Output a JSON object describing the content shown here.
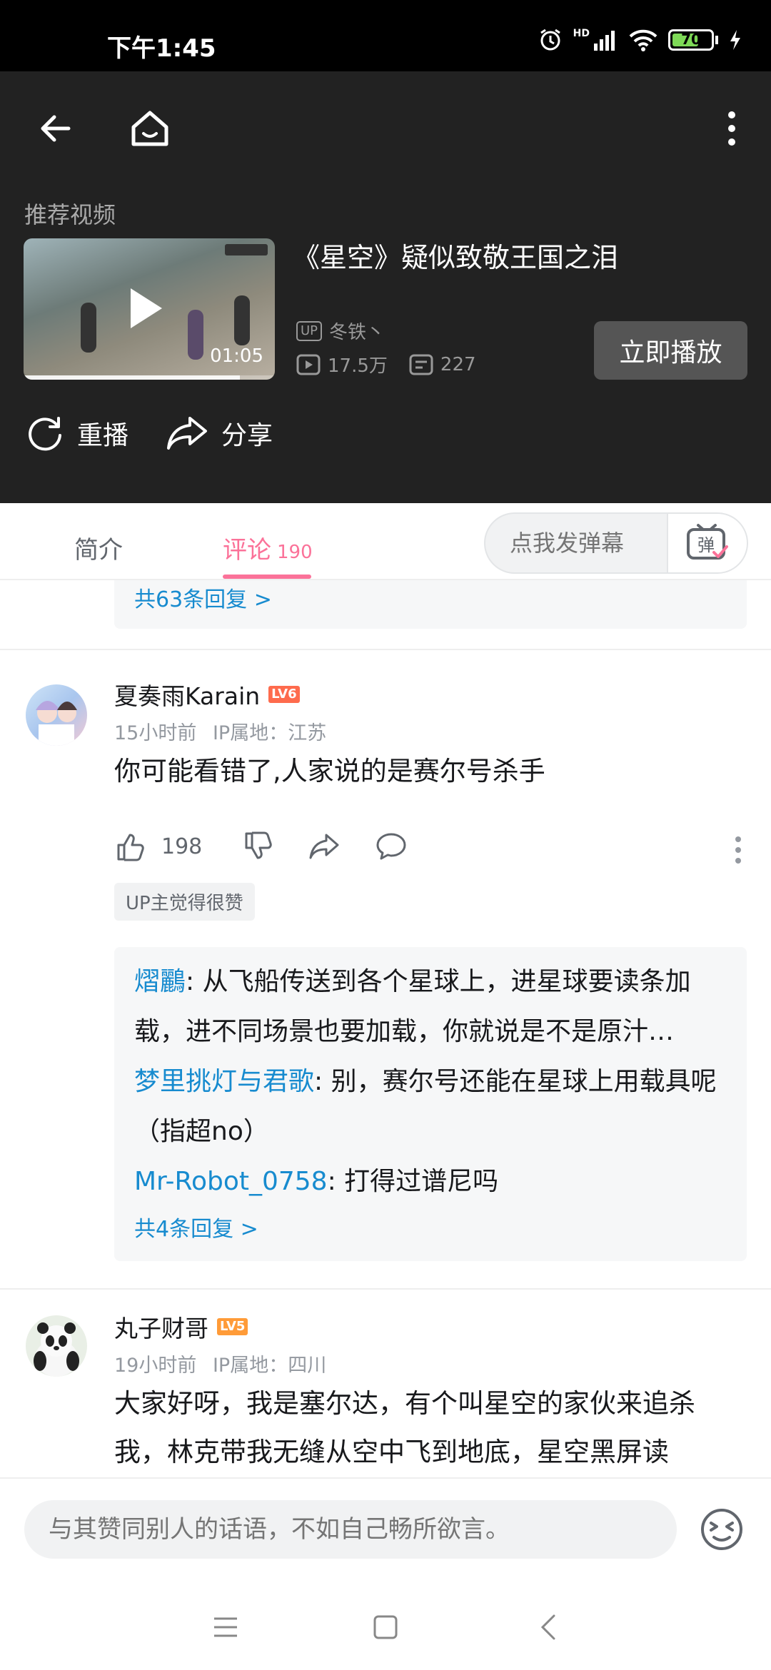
{
  "status_bar": {
    "time": "下午1:45",
    "battery": "70",
    "battery_level": 0.7,
    "network": "HD"
  },
  "header": {
    "back_icon": "back-arrow-icon",
    "home_icon": "home-icon",
    "more_icon": "more-vertical-icon"
  },
  "recommend": {
    "label": "推荐视频",
    "title": "《星空》疑似致敬王国之泪",
    "duration": "01:05",
    "progress": 0.86,
    "uploader": "冬铁丶",
    "up_badge": "UP",
    "views": "17.5万",
    "danmaku_count": "227",
    "play_now": "立即播放"
  },
  "actions": {
    "replay": "重播",
    "share": "分享"
  },
  "tabs": {
    "intro": "简介",
    "comments": "评论",
    "comments_count": "190",
    "danmaku_placeholder": "点我发弹幕",
    "danmaku_btn": "弹"
  },
  "colors": {
    "accent": "#fb7299",
    "link": "#178bcf",
    "lv6": "#fe6b4d",
    "lv5": "#ff9b38"
  },
  "top_partial": {
    "more_replies": "共63条回复 >"
  },
  "comments": [
    {
      "user": "夏奏雨Karain",
      "level": "LV6",
      "time": "15小时前",
      "location": "IP属地：江苏",
      "text": "你可能看错了,人家说的是赛尔号杀手",
      "likes": "198",
      "up_liked": "UP主觉得很赞",
      "replies": [
        {
          "name": "熠鸝",
          "text": ": 从飞船传送到各个星球上，进星球要读条加载，进不同场景也要加载，你就说是不是原汁…"
        },
        {
          "name": "梦里挑灯与君歌",
          "text": ": 别，赛尔号还能在星球上用载具呢（指超no）"
        },
        {
          "name": "Mr-Robot_0758",
          "text": ": 打得过谱尼吗"
        }
      ],
      "more_replies": "共4条回复 >"
    },
    {
      "user": "丸子财哥",
      "level": "LV5",
      "time": "19小时前",
      "location": "IP属地：四川",
      "text": "大家好呀，我是塞尔达，有个叫星空的家伙来追杀我，林克带我无缝从空中飞到地底，星空黑屏读"
    }
  ],
  "comment_input": {
    "placeholder": "与其赞同别人的话语，不如自己畅所欲言。"
  }
}
